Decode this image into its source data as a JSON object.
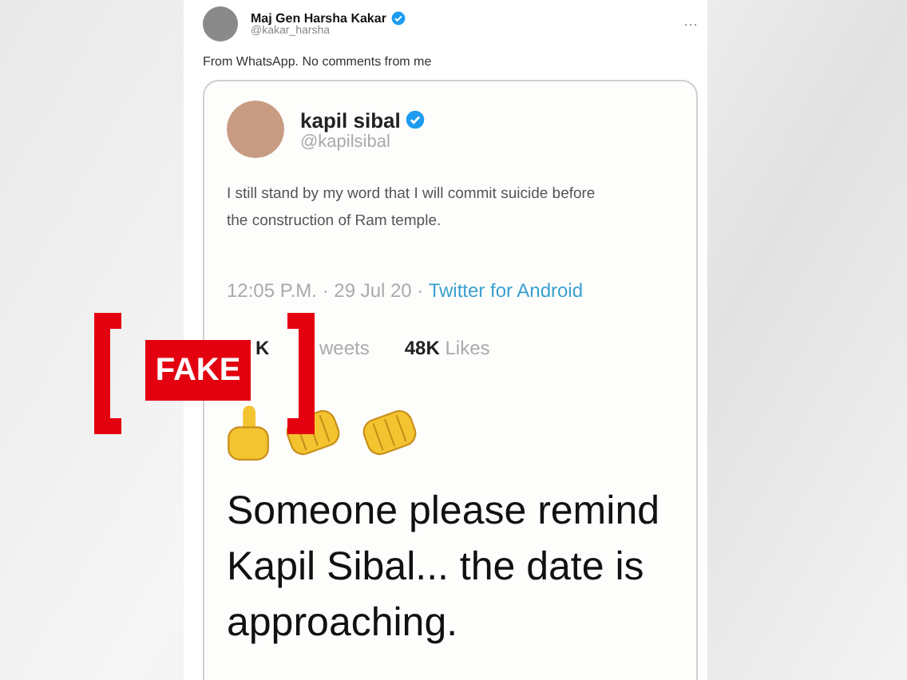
{
  "post": {
    "author": "Maj Gen Harsha Kakar",
    "verified": true,
    "handle": "@kakar_harsha",
    "more": "···",
    "text": "From WhatsApp. No comments from me"
  },
  "quoted": {
    "author": "kapil sibal",
    "verified": true,
    "handle": "@kapilsibal",
    "text": "I still stand by my word that I will commit suicide before the construction of Ram temple.",
    "time": "12:05 P.M. · 29 Jul 20 · ",
    "source": "Twitter for Android",
    "stats": [
      {
        "count": "K",
        "label": "weets"
      },
      {
        "count": "48K",
        "label": "Likes"
      }
    ],
    "caption": "Someone please remind Kapil Sibal... the date is approaching."
  },
  "stamp": {
    "label": "FAKE"
  }
}
